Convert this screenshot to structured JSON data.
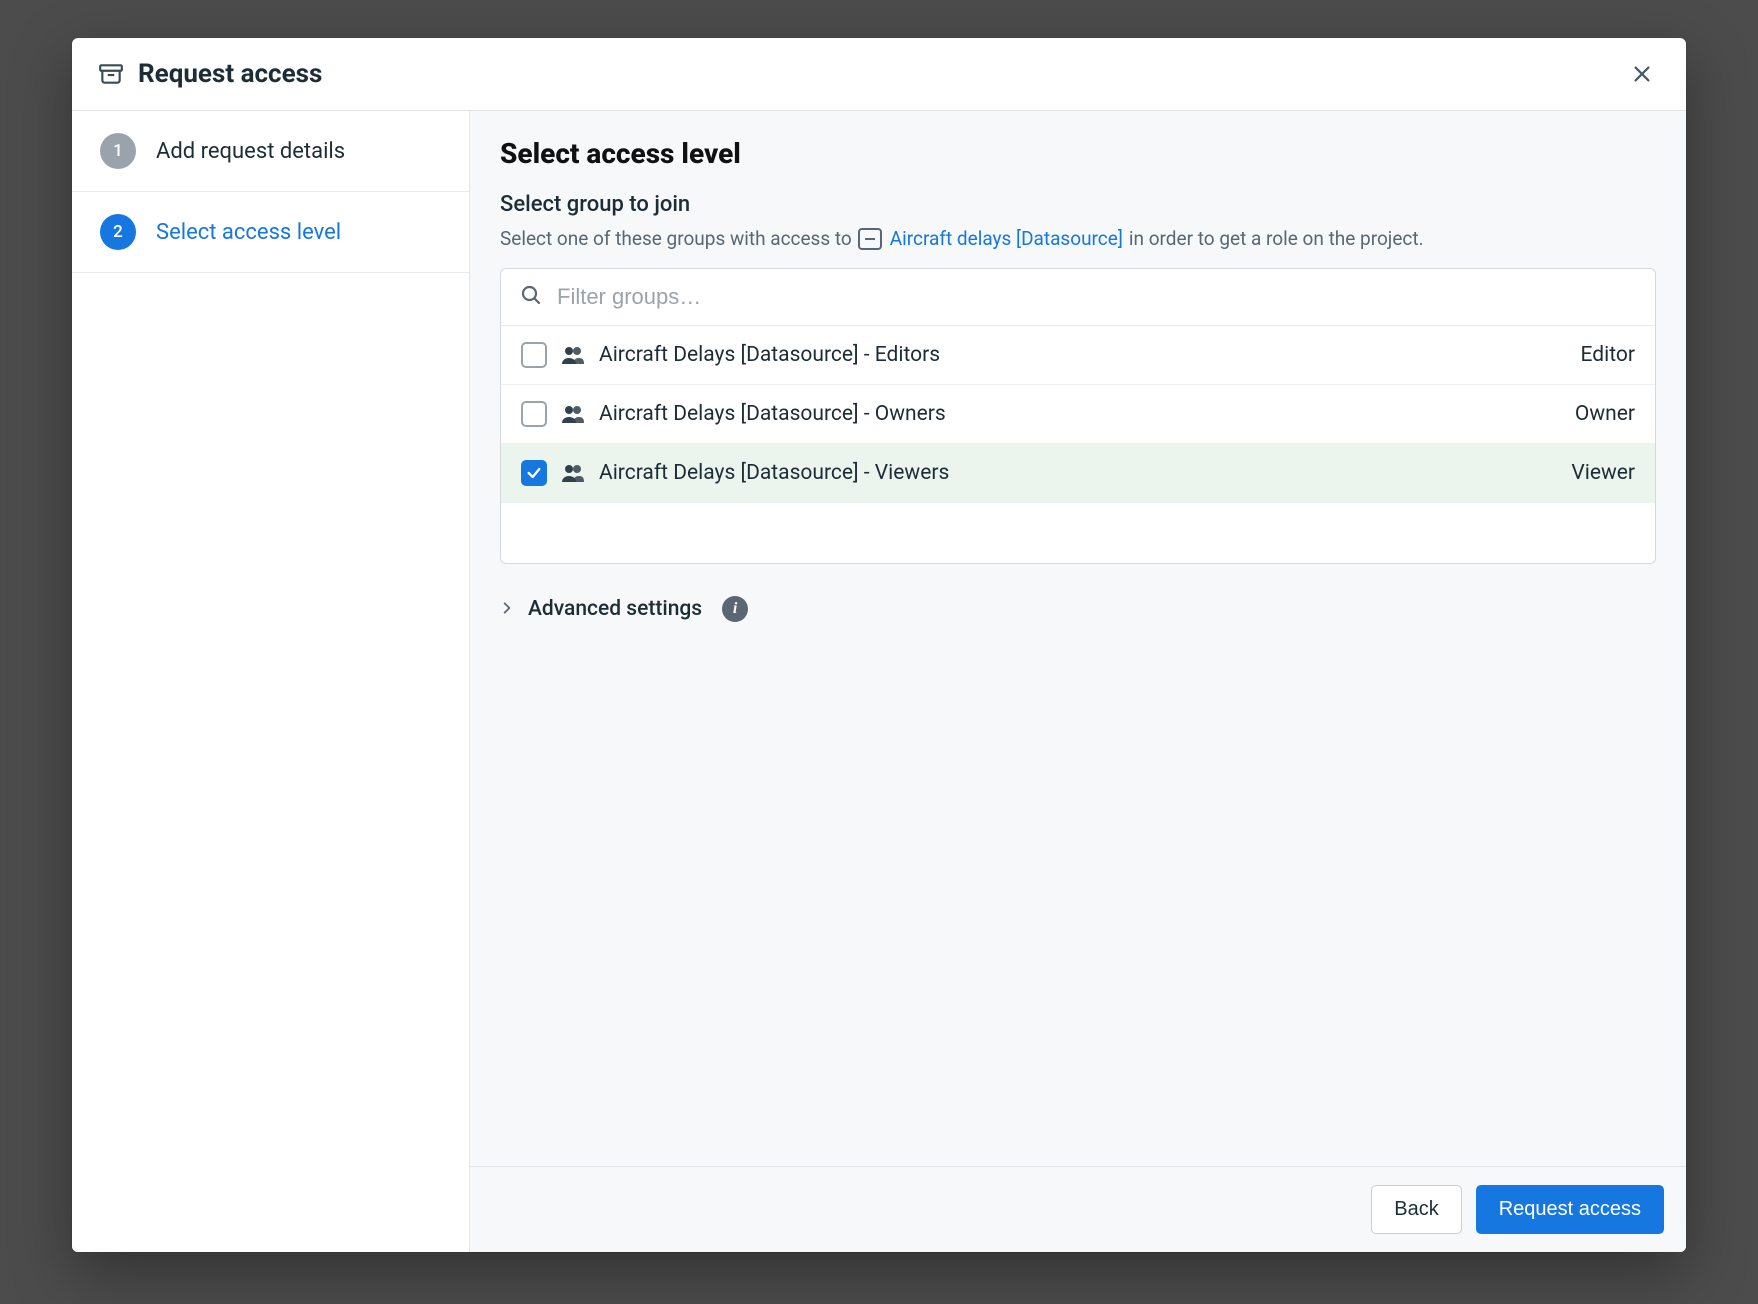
{
  "header": {
    "title": "Request access"
  },
  "steps": [
    {
      "num": "1",
      "label": "Add request details"
    },
    {
      "num": "2",
      "label": "Select access level"
    }
  ],
  "main": {
    "title": "Select access level",
    "subhead": "Select group to join",
    "desc_prefix": "Select one of these groups with access to",
    "target_name": "Aircraft delays [Datasource]",
    "desc_suffix": "in order to get a role on the project."
  },
  "filter": {
    "placeholder": "Filter groups…"
  },
  "groups": [
    {
      "name": "Aircraft Delays [Datasource] - Editors",
      "role": "Editor",
      "checked": false
    },
    {
      "name": "Aircraft Delays [Datasource] - Owners",
      "role": "Owner",
      "checked": false
    },
    {
      "name": "Aircraft Delays [Datasource] - Viewers",
      "role": "Viewer",
      "checked": true
    }
  ],
  "advanced": {
    "label": "Advanced settings"
  },
  "footer": {
    "back": "Back",
    "submit": "Request access"
  }
}
